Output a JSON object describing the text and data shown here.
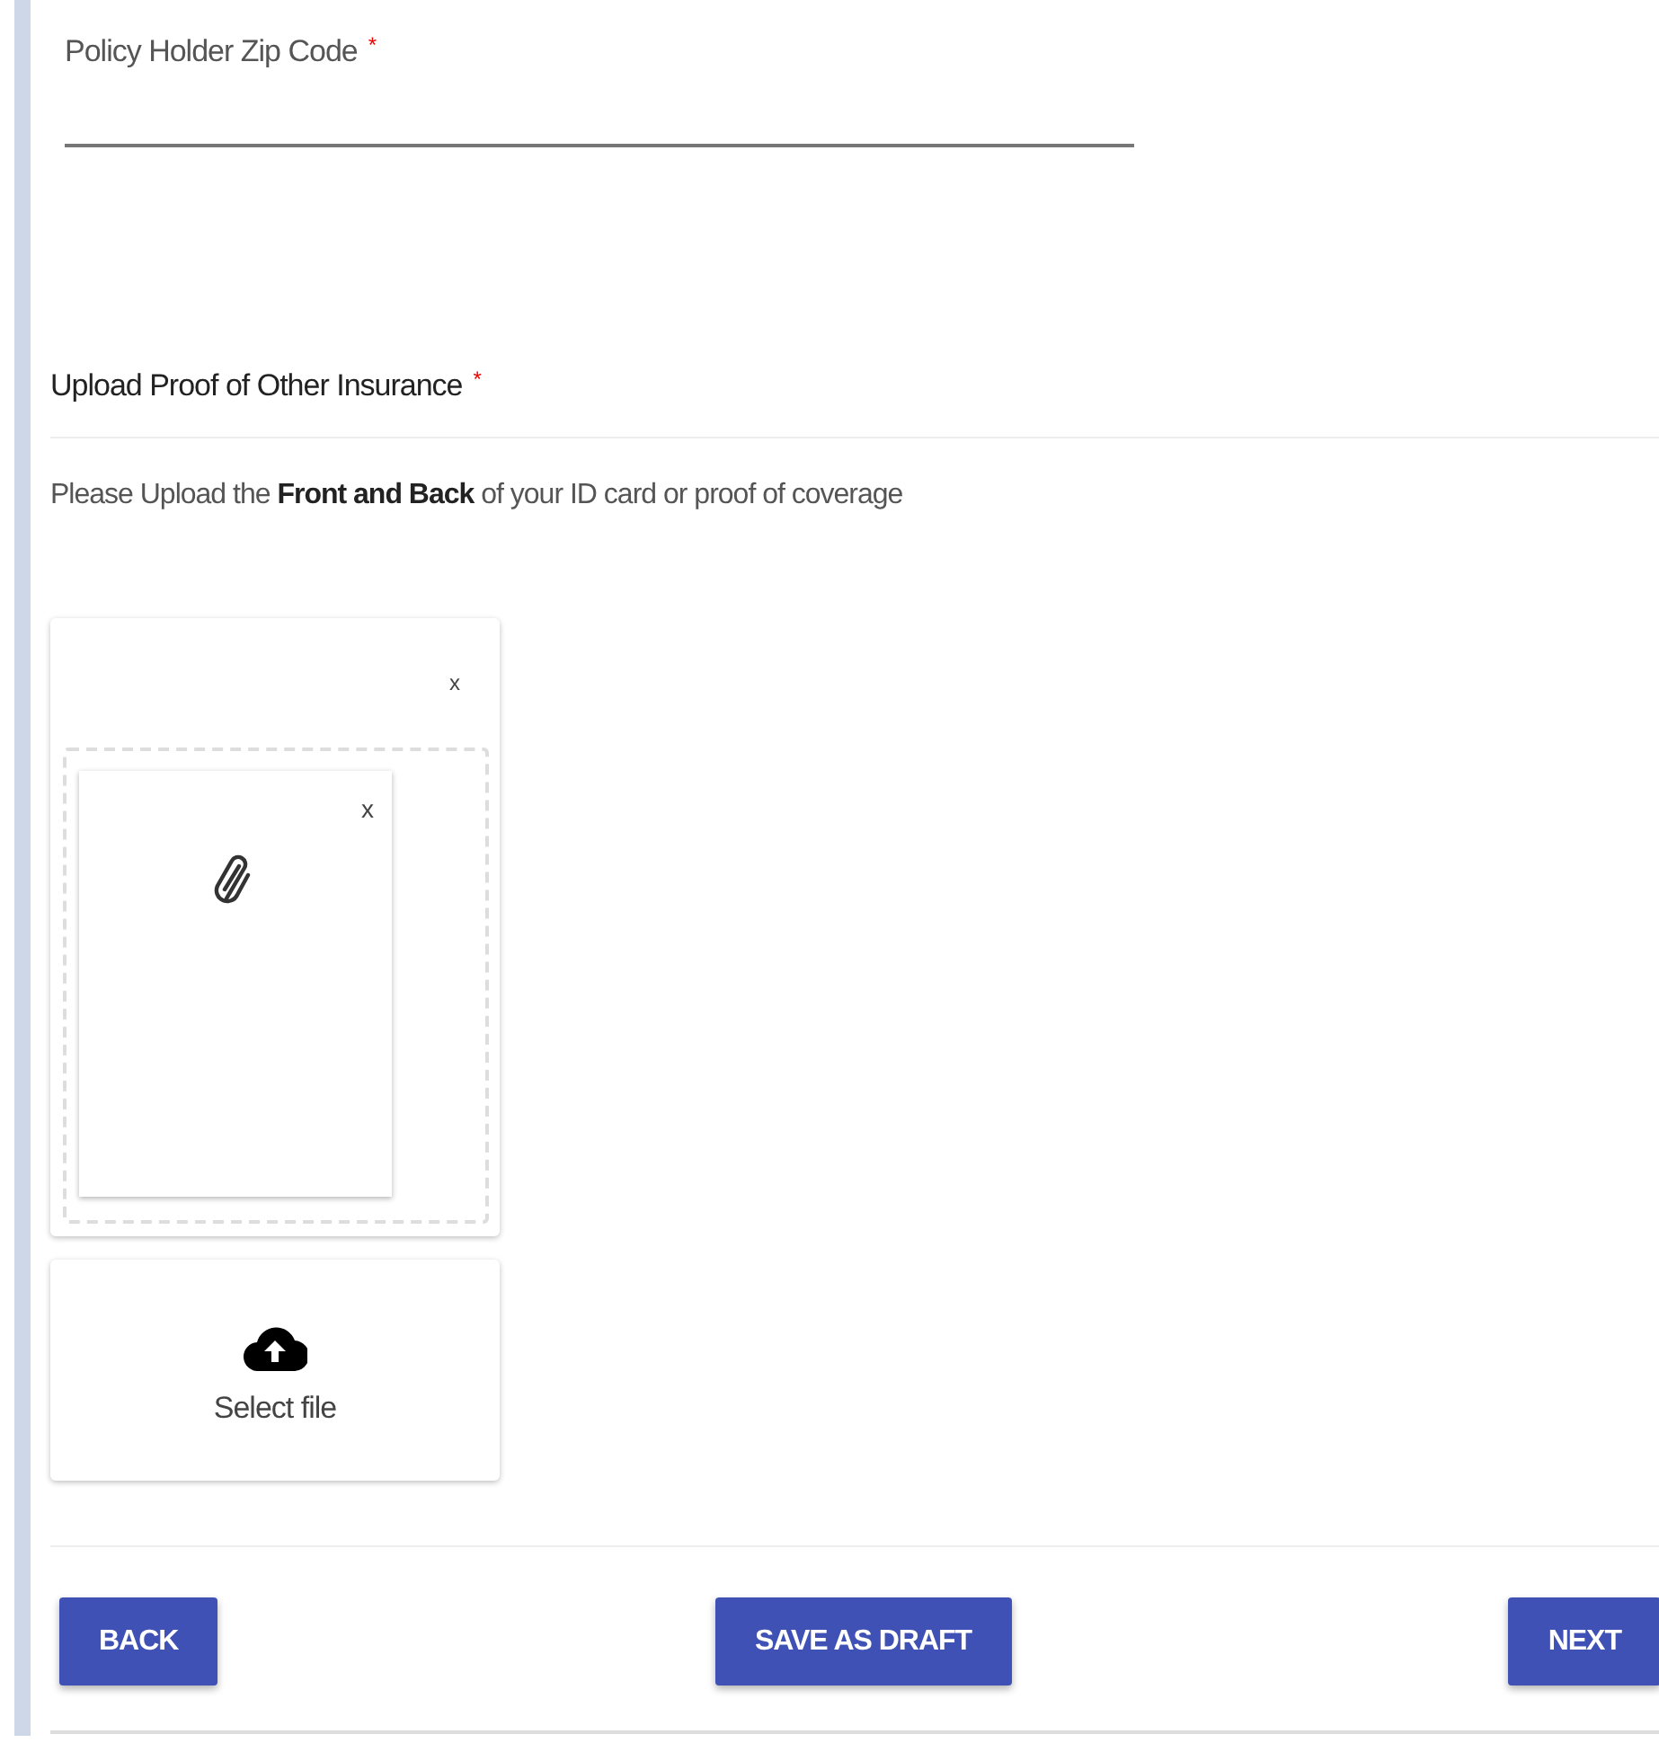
{
  "zip_field": {
    "label": "Policy Holder Zip Code",
    "required_mark": "*"
  },
  "upload_section": {
    "title": "Upload Proof of Other Insurance",
    "required_mark": "*",
    "description": "Please Upload the **Front and Back** of your ID card or proof of coverage",
    "file_card": {
      "close": "x",
      "preview_close": "x"
    },
    "select_button": {
      "label": "Select file"
    }
  },
  "buttons": [
    {
      "label": "BACK"
    },
    {
      "label": "SAVE AS DRAFT"
    },
    {
      "label": "NEXT"
    }
  ]
}
